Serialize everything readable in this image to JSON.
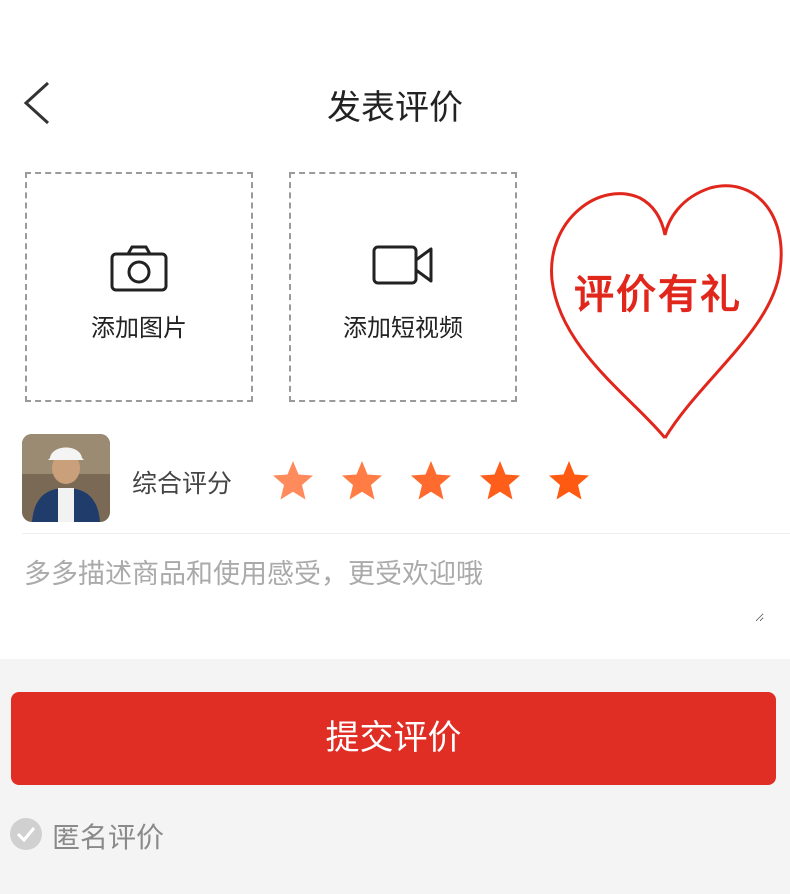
{
  "header": {
    "title": "发表评价"
  },
  "uploads": [
    {
      "label": "添加图片",
      "icon": "camera-icon"
    },
    {
      "label": "添加短视频",
      "icon": "video-camera-icon"
    }
  ],
  "promo": {
    "text": "评价有礼",
    "color": "#e1261c"
  },
  "rating": {
    "label": "综合评分",
    "value": 5,
    "max": 5,
    "star_colors": [
      "#ff8a5c",
      "#ff7c45",
      "#ff6b2e",
      "#ff5e1a",
      "#ff5a12"
    ]
  },
  "review": {
    "placeholder": "多多描述商品和使用感受，更受欢迎哦",
    "value": ""
  },
  "submit": {
    "label": "提交评价",
    "color": "#e02e25"
  },
  "anonymous": {
    "label": "匿名评价",
    "checked": false
  }
}
